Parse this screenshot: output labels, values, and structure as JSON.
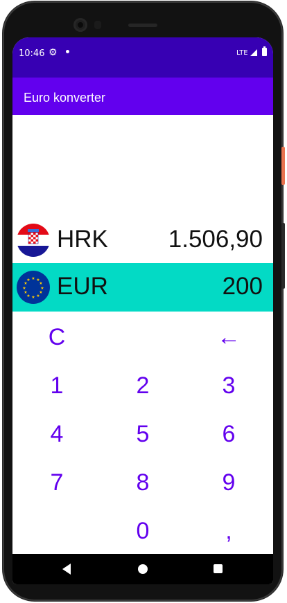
{
  "status_bar": {
    "time": "10:46",
    "network": "LTE",
    "icons": [
      "gear-icon",
      "notification-dot-icon",
      "signal-icon",
      "battery-icon"
    ]
  },
  "app_bar": {
    "title": "Euro konverter"
  },
  "colors": {
    "status_bar": "#3700b3",
    "app_bar": "#6200ee",
    "selected_row": "#03dac5",
    "key_text": "#6200ee"
  },
  "currencies": [
    {
      "code": "HRK",
      "amount": "1.506,90",
      "flag_icon": "croatia-flag-icon",
      "selected": false
    },
    {
      "code": "EUR",
      "amount": "200",
      "flag_icon": "eu-flag-icon",
      "selected": true
    }
  ],
  "keypad": {
    "clear": "C",
    "backspace": "←",
    "digits": [
      "1",
      "2",
      "3",
      "4",
      "5",
      "6",
      "7",
      "8",
      "9",
      "0"
    ],
    "decimal": ","
  },
  "nav_bar": {
    "icons": [
      "back-icon",
      "home-icon",
      "recents-icon"
    ]
  }
}
